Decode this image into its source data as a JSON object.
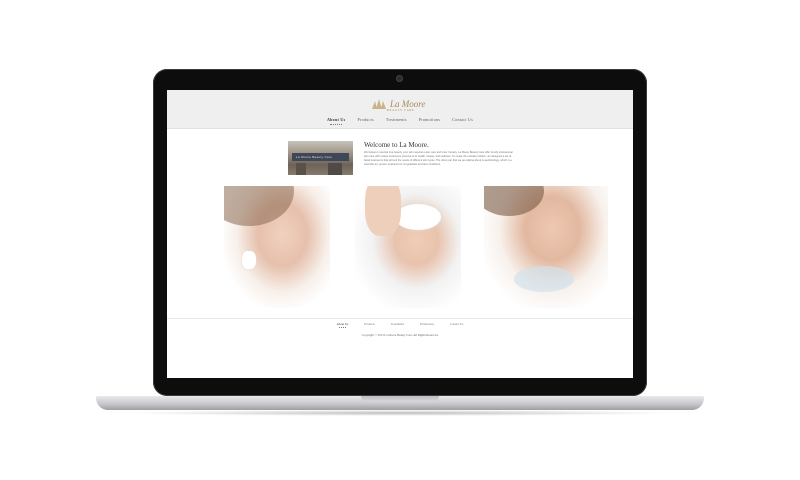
{
  "site": {
    "logo_text": "La Moore",
    "logo_subtitle": "BEAUTY CARE",
    "nav": [
      {
        "label": "About Us",
        "active": true
      },
      {
        "label": "Products",
        "active": false
      },
      {
        "label": "Treatments",
        "active": false
      },
      {
        "label": "Promotions",
        "active": false
      },
      {
        "label": "Contact Us",
        "active": false
      }
    ],
    "storefront_sign": "La Moore Beauty Care",
    "welcome_title": "Welcome to La Moore.",
    "intro_text": "We believe in eternal true beauty, your skin requires outer care and inner therapy. La Moore Beauty Care offer trendy professional skin care with unique treatments protocol to its health, beauty, and wellness. To cease the outside problem, we designed a set of facial treatments that will suit the needs of different skin types. The other part that we are talking about is aesthetology, which is a scientific art, proven treatment for irregularities and skin conditions.",
    "footer_nav": [
      {
        "label": "About Us",
        "active": true
      },
      {
        "label": "Products",
        "active": false
      },
      {
        "label": "Treatments",
        "active": false
      },
      {
        "label": "Promotions",
        "active": false
      },
      {
        "label": "Contact Us",
        "active": false
      }
    ],
    "copyright": "Copyright © 2013 La Moore Beauty Care. All Rights Reserved.",
    "colors": {
      "accent": "#a68b5b",
      "header_bg": "#efefef",
      "laptop_bezel": "#0d0d0d"
    }
  }
}
